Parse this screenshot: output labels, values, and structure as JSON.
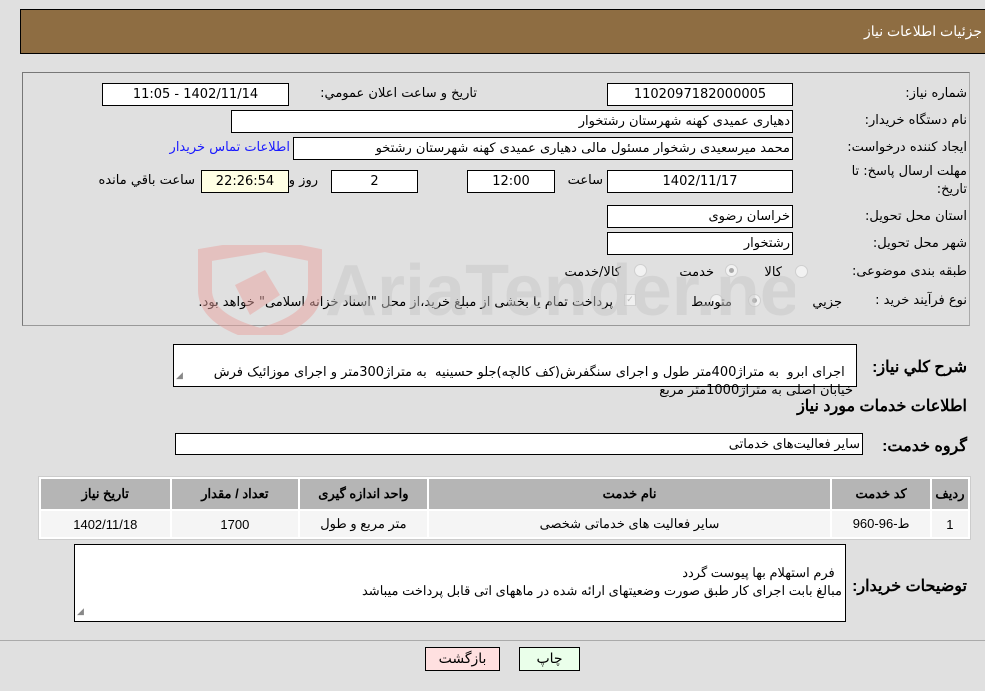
{
  "header": {
    "title": "جزئیات اطلاعات نیاز"
  },
  "form": {
    "need_number": {
      "label": "شماره نیاز:",
      "value": "1102097182000005"
    },
    "announce_datetime": {
      "label": "تاریخ و ساعت اعلان عمومي:",
      "value": "1402/11/14 - 11:05"
    },
    "buyer_org": {
      "label": "نام دستگاه خریدار:",
      "value": "دهیاری عمیدی کهنه شهرستان رشتخوار"
    },
    "requester": {
      "label": "ایجاد کننده درخواست:",
      "value": "محمد میرسعیدی رشخوار مسئول مالی دهیاری عمیدی کهنه شهرستان رشتخو"
    },
    "buyer_contact_link": "اطلاعات تماس خریدار",
    "deadline": {
      "label_line1": "مهلت ارسال پاسخ: تا",
      "label_line2": "تاریخ:",
      "date": "1402/11/17",
      "time_label": "ساعت",
      "time": "12:00",
      "days": "2",
      "days_label": "روز و",
      "remaining": "22:26:54",
      "remaining_label": "ساعت باقي مانده"
    },
    "province": {
      "label": "استان محل تحویل:",
      "value": "خراسان رضوی"
    },
    "city": {
      "label": "شهر محل تحویل:",
      "value": "رشتخوار"
    },
    "category": {
      "label": "طبقه بندی موضوعی:",
      "options": [
        "کالا",
        "خدمت",
        "کالا/خدمت"
      ],
      "selected": "خدمت"
    },
    "purchase_type": {
      "label": "نوع فرآیند خرید :",
      "options": [
        "جزيي",
        "متوسط"
      ],
      "selected": "متوسط",
      "treasury_checkbox_label": "پرداخت تمام یا بخشی از مبلغ خرید،از محل \"اسناد خزانه اسلامی\" خواهد بود.",
      "treasury_checked": true
    }
  },
  "description": {
    "label": "شرح کلي نیاز:",
    "value": "اجرای ابرو  به متراژ400متر طول و اجرای سنگفرش(کف کالچه)جلو حسینیه  به متراژ300متر و اجرای موزائیک فرش خیابان اصلی به متراژ1000متر مربع"
  },
  "services_section_title": "اطلاعات خدمات مورد نیاز",
  "service_group": {
    "label": "گروه خدمت:",
    "value": "سایر فعالیت‌های خدماتی"
  },
  "table": {
    "headers": [
      "ردیف",
      "کد خدمت",
      "نام خدمت",
      "واحد اندازه گیری",
      "تعداد / مقدار",
      "تاریخ نیاز"
    ],
    "rows": [
      [
        "1",
        "ط-96-960",
        "سایر فعالیت های خدماتی شخصی",
        "متر مربع و طول",
        "1700",
        "1402/11/18"
      ]
    ]
  },
  "buyer_notes": {
    "label": "توضیحات خریدار:",
    "value": "فرم استهلام بها پیوست گردد\nمبالغ بابت اجرای کار طبق صورت وضعیتهای ارائه شده در ماههای اتی قابل پرداخت میباشد"
  },
  "buttons": {
    "print": "چاپ",
    "back": "بازگشت"
  },
  "watermark": {
    "text": "AriaTender.neT",
    "colors": {
      "red": "#d9534f",
      "gray": "#999999"
    }
  }
}
